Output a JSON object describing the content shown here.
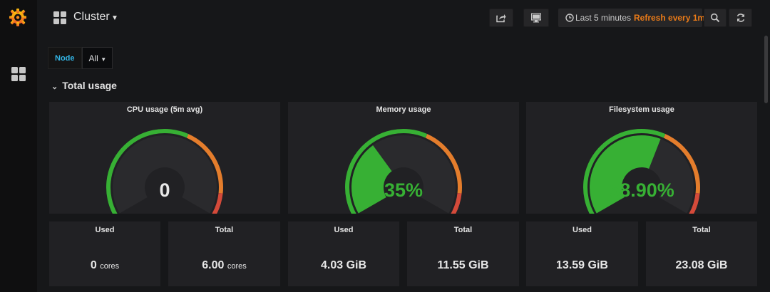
{
  "navbar": {
    "title": "Cluster",
    "time_range": "Last 5 minutes",
    "refresh": "Refresh every 1m"
  },
  "variables": {
    "label": "Node",
    "value": "All"
  },
  "row": {
    "title": "Total usage"
  },
  "gauges": [
    {
      "title": "CPU usage (5m avg)",
      "display": "0",
      "fraction": 0,
      "value_color": "#e8e8e8"
    },
    {
      "title": "Memory usage",
      "display": "35%",
      "fraction": 0.35,
      "value_color": "#37b034"
    },
    {
      "title": "Filesystem usage",
      "display": "58.90%",
      "fraction": 0.589,
      "value_color": "#37b034"
    }
  ],
  "stats": [
    {
      "title": "Used",
      "value": "0",
      "unit": "cores"
    },
    {
      "title": "Total",
      "value": "6.00",
      "unit": "cores"
    },
    {
      "title": "Used",
      "value": "4.03 GiB",
      "unit": ""
    },
    {
      "title": "Total",
      "value": "11.55 GiB",
      "unit": ""
    },
    {
      "title": "Used",
      "value": "13.59 GiB",
      "unit": ""
    },
    {
      "title": "Total",
      "value": "23.08 GiB",
      "unit": ""
    }
  ],
  "colors": {
    "ok": "#37b034",
    "warn": "#e47d2c",
    "crit": "#d44a3a",
    "refresh": "#eb7b18",
    "variable_label": "#33b5e5"
  }
}
